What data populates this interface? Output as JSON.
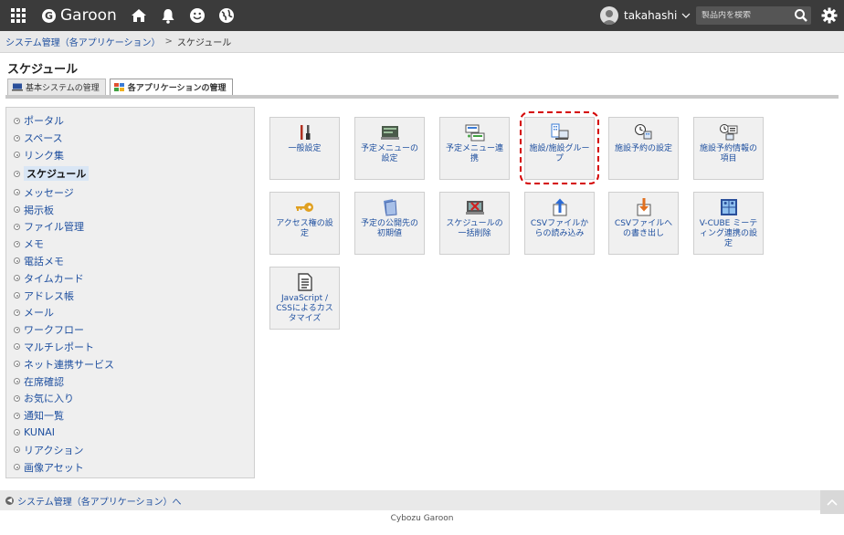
{
  "header": {
    "logo_text": "Garoon",
    "user_name": "takahashi",
    "search_placeholder": "製品内を検索"
  },
  "breadcrumb": {
    "parent": "システム管理（各アプリケーション）",
    "separator": ">",
    "current": "スケジュール"
  },
  "page_title": "スケジュール",
  "tabs": [
    {
      "label": "基本システムの管理",
      "active": false
    },
    {
      "label": "各アプリケーションの管理",
      "active": true
    }
  ],
  "sidebar": {
    "items": [
      {
        "label": "ポータル"
      },
      {
        "label": "スペース"
      },
      {
        "label": "リンク集"
      },
      {
        "label": "スケジュール",
        "current": true
      },
      {
        "label": "メッセージ"
      },
      {
        "label": "掲示板"
      },
      {
        "label": "ファイル管理"
      },
      {
        "label": "メモ"
      },
      {
        "label": "電話メモ"
      },
      {
        "label": "タイムカード"
      },
      {
        "label": "アドレス帳"
      },
      {
        "label": "メール"
      },
      {
        "label": "ワークフロー"
      },
      {
        "label": "マルチレポート"
      },
      {
        "label": "ネット連携サービス"
      },
      {
        "label": "在席確認"
      },
      {
        "label": "お気に入り"
      },
      {
        "label": "通知一覧"
      },
      {
        "label": "KUNAI"
      },
      {
        "label": "リアクション"
      },
      {
        "label": "画像アセット"
      }
    ]
  },
  "tiles": [
    {
      "label": "一般設定",
      "icon": "tools-icon"
    },
    {
      "label": "予定メニューの設定",
      "icon": "menu-book-icon"
    },
    {
      "label": "予定メニュー連携",
      "icon": "menu-link-icon"
    },
    {
      "label": "施設/施設グループ",
      "icon": "facility-icon",
      "highlighted": true
    },
    {
      "label": "施設予約の設定",
      "icon": "facility-clock-icon"
    },
    {
      "label": "施設予約情報の項目",
      "icon": "facility-info-icon"
    },
    {
      "label": "アクセス権の設定",
      "icon": "key-icon"
    },
    {
      "label": "予定の公開先の初期値",
      "icon": "folder-icon"
    },
    {
      "label": "スケジュールの一括削除",
      "icon": "delete-icon"
    },
    {
      "label": "CSVファイルからの読み込み",
      "icon": "import-icon"
    },
    {
      "label": "CSVファイルへの書き出し",
      "icon": "export-icon"
    },
    {
      "label": "V-CUBE ミーティング連携の設定",
      "icon": "vcube-icon"
    },
    {
      "label": "JavaScript / CSSによるカスタマイズ",
      "icon": "document-icon"
    }
  ],
  "back_link": "システム管理（各アプリケーション）へ",
  "footer": "Cybozu Garoon",
  "colors": {
    "header_bg": "#3b3b3b",
    "link": "#1e4f9f",
    "highlight": "#d40000"
  }
}
